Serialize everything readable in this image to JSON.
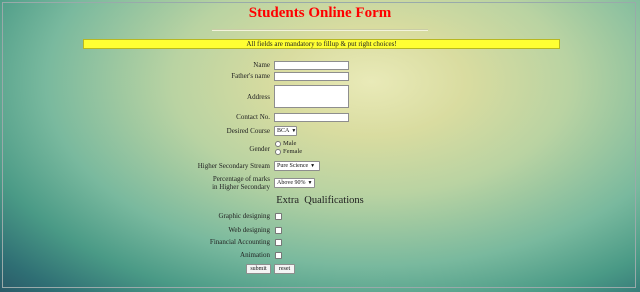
{
  "form": {
    "title": "Students Online Form",
    "notice": "All fields are mandatory to fillup & put right choices!",
    "fields": {
      "name_label": "Name",
      "father_label": "Father's name",
      "address_label": "Address",
      "contact_label": "Contact No.",
      "course_label": "Desired Course",
      "course_value": "BCA",
      "gender_label": "Gender",
      "gender_male": "Male",
      "gender_female": "Female",
      "stream_label": "Higher Secondary Stream",
      "stream_value": "Pure Science",
      "marks_label_line1": "Percentage of marks",
      "marks_label_line2": "in Higher Secondary",
      "marks_value": "Above 90%"
    },
    "extra": {
      "heading_word1": "Extra",
      "heading_word2": "Qualifications",
      "items": [
        "Graphic designing",
        "Web designing",
        "Financial Accounting",
        "Animation"
      ]
    },
    "buttons": {
      "submit": "submit",
      "reset": "reset"
    }
  }
}
